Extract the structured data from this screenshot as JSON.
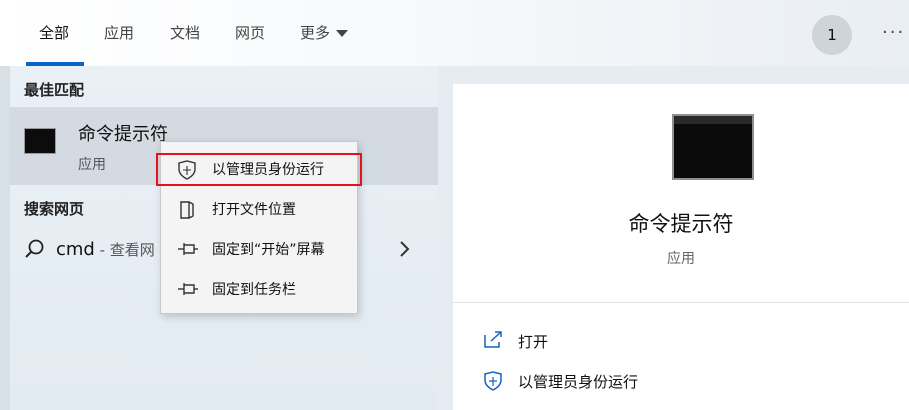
{
  "tabs": [
    {
      "label": "全部",
      "active": true
    },
    {
      "label": "应用"
    },
    {
      "label": "文档"
    },
    {
      "label": "网页"
    },
    {
      "label": "更多"
    }
  ],
  "user": {
    "avatar_text": "1"
  },
  "more_options": "···",
  "colors": {
    "accent": "#0a63c9",
    "highlight_box": "#e0141e"
  },
  "left": {
    "best_match_title": "最佳匹配",
    "best_match": {
      "name": "命令提示符",
      "type": "应用",
      "icon": "terminal-icon"
    },
    "search_web_title": "搜索网页",
    "search_row": {
      "query": "cmd",
      "suffix": " - 查看网"
    }
  },
  "context_menu": {
    "items": [
      {
        "label": "以管理员身份运行",
        "icon": "shield-icon"
      },
      {
        "label": "打开文件位置",
        "icon": "folder-location-icon"
      },
      {
        "label": "固定到“开始”屏幕",
        "icon": "pin-icon"
      },
      {
        "label": "固定到任务栏",
        "icon": "pin-icon"
      }
    ]
  },
  "right": {
    "title": "命令提示符",
    "type": "应用",
    "actions": [
      {
        "label": "打开",
        "icon": "open-icon"
      },
      {
        "label": "以管理员身份运行",
        "icon": "shield-icon"
      }
    ]
  }
}
